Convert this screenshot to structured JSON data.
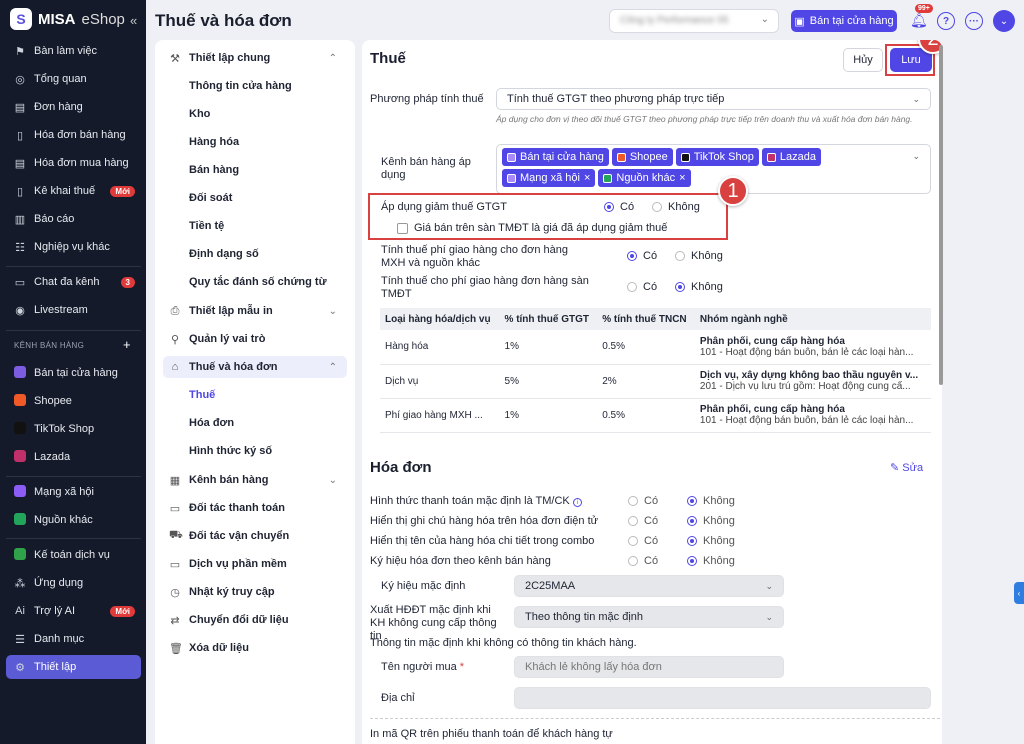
{
  "app": {
    "brand": "MISA",
    "brand_suffix": "eShop",
    "collapse": "«"
  },
  "sidebar": {
    "groups": [
      [
        {
          "icon": "⚑",
          "label": "Bàn làm việc",
          "name": "desk-icon"
        },
        {
          "icon": "◎",
          "label": "Tổng quan",
          "name": "gauge-icon"
        },
        {
          "icon": "▤",
          "label": "Đơn hàng",
          "name": "order-icon"
        },
        {
          "icon": "▯",
          "label": "Hóa đơn bán hàng",
          "name": "invoice-icon"
        },
        {
          "icon": "▤",
          "label": "Hóa đơn mua hàng",
          "name": "receipt-icon"
        },
        {
          "icon": "▯",
          "label": "Kê khai thuế",
          "name": "tax-file-icon",
          "badge": "Mới"
        },
        {
          "icon": "▥",
          "label": "Báo cáo",
          "name": "chart-icon"
        },
        {
          "icon": "☷",
          "label": "Nghiệp vụ khác",
          "name": "list-icon"
        }
      ],
      [
        {
          "icon": "▭",
          "label": "Chat đa kênh",
          "name": "chat-icon",
          "badge": "3"
        },
        {
          "icon": "◉",
          "label": "Livestream",
          "name": "livestream-icon"
        }
      ],
      [
        {
          "dot": "#7c5ce0",
          "label": "Bán tại cửa hàng",
          "name": "store-icon"
        },
        {
          "dot": "#f05a28",
          "label": "Shopee",
          "name": "shopee-icon"
        },
        {
          "dot": "#111111",
          "label": "TikTok Shop",
          "name": "tiktok-icon"
        },
        {
          "dot": "#c0306a",
          "label": "Lazada",
          "name": "lazada-icon"
        }
      ],
      [
        {
          "dot": "#8b5cf6",
          "label": "Mạng xã hội",
          "name": "social-icon"
        },
        {
          "dot": "#22a55a",
          "label": "Nguồn khác",
          "name": "other-source-icon"
        }
      ],
      [
        {
          "dot": "#2fa24a",
          "label": "Kế toán dịch vụ",
          "name": "accounting-icon"
        },
        {
          "icon": "⁂",
          "label": "Ứng dụng",
          "name": "apps-icon"
        },
        {
          "icon": "Ai",
          "label": "Trợ lý AI",
          "name": "ai-icon",
          "badge": "Mới"
        },
        {
          "icon": "☰",
          "label": "Danh mục",
          "name": "catalog-icon"
        },
        {
          "icon": "⚙",
          "label": "Thiết lập",
          "name": "gear-icon",
          "active": true
        }
      ]
    ],
    "section_label": "KÊNH BÁN HÀNG",
    "section_add": "+"
  },
  "header": {
    "title": "Thuế và hóa đơn",
    "company": "Công ty Performance 05",
    "store_button": "Bán tại cửa hàng",
    "notif_count": "99+",
    "help": "?",
    "more": "···",
    "avatar": "⌄"
  },
  "nav": {
    "items": [
      {
        "label": "Thiết lập chung",
        "type": "parent",
        "icon": "⚒",
        "caret": "⌃"
      },
      {
        "label": "Thông tin cửa hàng",
        "type": "child"
      },
      {
        "label": "Kho",
        "type": "child"
      },
      {
        "label": "Hàng hóa",
        "type": "child"
      },
      {
        "label": "Bán hàng",
        "type": "child"
      },
      {
        "label": "Đối soát",
        "type": "child"
      },
      {
        "label": "Tiền tệ",
        "type": "child"
      },
      {
        "label": "Định dạng số",
        "type": "child"
      },
      {
        "label": "Quy tắc đánh số chứng từ",
        "type": "child"
      },
      {
        "label": "Thiết lập mẫu in",
        "type": "parent",
        "icon": "⎙",
        "caret": "⌄"
      },
      {
        "label": "Quản lý vai trò",
        "type": "parent",
        "icon": "⚲"
      },
      {
        "label": "Thuế và hóa đơn",
        "type": "parent",
        "icon": "⌂",
        "caret": "⌃",
        "active": true
      },
      {
        "label": "Thuế",
        "type": "child",
        "selected": true
      },
      {
        "label": "Hóa đơn",
        "type": "child"
      },
      {
        "label": "Hình thức ký số",
        "type": "child"
      },
      {
        "label": "Kênh bán hàng",
        "type": "parent",
        "icon": "▦",
        "caret": "⌄"
      },
      {
        "label": "Đối tác thanh toán",
        "type": "parent",
        "icon": "▭"
      },
      {
        "label": "Đối tác vận chuyển",
        "type": "parent",
        "icon": "⛟"
      },
      {
        "label": "Dịch vụ phần mềm",
        "type": "parent",
        "icon": "▭"
      },
      {
        "label": "Nhật ký truy cập",
        "type": "parent",
        "icon": "◷"
      },
      {
        "label": "Chuyển đổi dữ liệu",
        "type": "parent",
        "icon": "⇄"
      },
      {
        "label": "Xóa dữ liệu",
        "type": "parent",
        "icon": "🗑"
      }
    ]
  },
  "tax": {
    "title": "Thuế",
    "cancel": "Hủy",
    "save": "Lưu",
    "method_label": "Phương pháp tính thuế",
    "method_value": "Tính thuế GTGT theo phương pháp trực tiếp",
    "method_hint": "Áp dụng cho đơn vị theo dõi thuế GTGT theo phương pháp trực tiếp trên doanh thu và xuất hóa đơn bán hàng.",
    "channels_label": "Kênh bán hàng áp dụng",
    "channels": [
      {
        "label": "Bán tại cửa hàng",
        "color": "#a78bfa"
      },
      {
        "label": "Shopee",
        "color": "#f05a28"
      },
      {
        "label": "TikTok Shop",
        "color": "#111111"
      },
      {
        "label": "Lazada",
        "color": "#c0306a"
      },
      {
        "label": "Mạng xã hội",
        "color": "#a78bfa",
        "x": "×"
      },
      {
        "label": "Nguồn khác",
        "color": "#22a55a",
        "x": "×"
      }
    ],
    "reduce_label": "Áp dụng giảm thuế GTGT",
    "yes": "Có",
    "no": "Không",
    "reduce_checkbox": "Giá bán trên sàn TMĐT là giá đã áp dụng giảm thuế",
    "ship_social_label": "Tính thuế phí giao hàng cho đơn hàng MXH và nguồn khác",
    "ship_ecom_label": "Tính thuế cho phí giao hàng đơn hàng sàn TMĐT",
    "table": {
      "headers": [
        "Loại hàng hóa/dịch vụ",
        "% tính thuế GTGT",
        "% tính thuế TNCN",
        "Nhóm ngành nghề"
      ],
      "rows": [
        [
          "Hàng hóa",
          "1%",
          "0.5%",
          "Phân phối, cung cấp hàng hóa",
          "101 - Hoạt động bán buôn, bán lẻ các loại hàn..."
        ],
        [
          "Dịch vụ",
          "5%",
          "2%",
          "Dịch vụ, xây dựng không bao thầu nguyên v...",
          "201 - Dịch vụ lưu trú gồm: Hoạt động cung cấ..."
        ],
        [
          "Phí giao hàng MXH ...",
          "1%",
          "0.5%",
          "Phân phối, cung cấp hàng hóa",
          "101 - Hoạt động bán buôn, bán lẻ các loại hàn..."
        ]
      ]
    }
  },
  "invoice": {
    "title": "Hóa đơn",
    "edit": "✎ Sửa",
    "options": [
      {
        "label": "Hình thức thanh toán mặc định là TM/CK",
        "info": "i"
      },
      {
        "label": "Hiển thị ghi chú hàng hóa trên hóa đơn điện tử"
      },
      {
        "label": "Hiển thị tên của hàng hóa chi tiết trong combo"
      },
      {
        "label": "Ký hiệu hóa đơn theo kênh bán hàng"
      }
    ],
    "symbol_label": "Ký hiệu mặc định",
    "symbol_value": "2C25MAA",
    "export_label": "Xuất HĐĐT mặc định khi KH không cung cấp thông tin",
    "export_value": "Theo thông tin mặc định",
    "default_info": "Thông tin mặc định khi không có thông tin khách hàng.",
    "buyer_label": "Tên người mua",
    "required": "*",
    "buyer_value": "Khách lẻ không lấy hóa đơn",
    "address_label": "Địa chỉ",
    "address_value": "",
    "qr_label": "In mã QR trên phiếu thanh toán để khách hàng tự"
  },
  "annotations": {
    "one": "1",
    "two": "2"
  },
  "colors": {
    "accent": "#4f46e5",
    "sidebar": "#141a2a",
    "annotation": "#d94040"
  }
}
